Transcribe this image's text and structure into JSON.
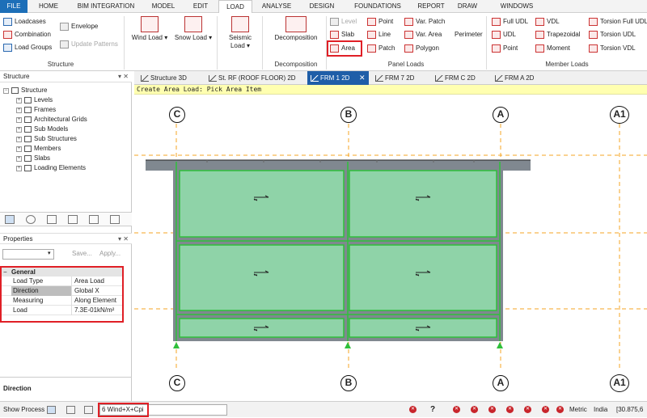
{
  "menu": {
    "items": [
      "FILE",
      "HOME",
      "BIM INTEGRATION",
      "MODEL",
      "EDIT",
      "LOAD",
      "ANALYSE",
      "DESIGN",
      "FOUNDATIONS",
      "REPORT",
      "DRAW",
      "WINDOWS"
    ],
    "active": "LOAD"
  },
  "ribbon": {
    "structure": {
      "loadcases": "Loadcases",
      "combination": "Combination",
      "load_groups": "Load Groups",
      "envelope": "Envelope",
      "update_patterns": "Update Patterns",
      "label": "Structure"
    },
    "wind_load": "Wind Load",
    "snow_load": "Snow Load",
    "seismic_load": "Seismic Load",
    "decomposition": {
      "button": "Decomposition",
      "label": "Decomposition"
    },
    "panel_loads": {
      "level": "Level",
      "slab": "Slab",
      "area": "Area",
      "point": "Point",
      "line": "Line",
      "patch": "Patch",
      "var_patch": "Var. Patch",
      "var_area": "Var. Area",
      "polygon": "Polygon",
      "perimeter": "Perimeter",
      "label": "Panel Loads"
    },
    "member_loads": {
      "full_udl": "Full UDL",
      "udl": "UDL",
      "point": "Point",
      "vdl": "VDL",
      "trapezoidal": "Trapezoidal",
      "moment": "Moment",
      "torsion_full_udl": "Torsion Full UDL",
      "torsion_udl": "Torsion UDL",
      "torsion_vdl": "Torsion VDL",
      "label": "Member Loads"
    }
  },
  "tabs": [
    {
      "label": "Structure 3D"
    },
    {
      "label": "St. RF (ROOF FLOOR) 2D"
    },
    {
      "label": "FRM 1 2D",
      "active": true
    },
    {
      "label": "FRM 7 2D"
    },
    {
      "label": "FRM C 2D"
    },
    {
      "label": "FRM A 2D"
    }
  ],
  "structure_panel": {
    "title": "Structure",
    "root": "Structure",
    "children": [
      "Levels",
      "Frames",
      "Architectural Grids",
      "Sub Models",
      "Sub Structures",
      "Members",
      "Slabs",
      "Loading Elements"
    ]
  },
  "properties_panel": {
    "title": "Properties",
    "save": "Save...",
    "apply": "Apply...",
    "group": "General",
    "rows": [
      {
        "key": "Load Type",
        "value": "Area Load"
      },
      {
        "key": "Direction",
        "value": "Global X"
      },
      {
        "key": "Measuring",
        "value": "Along Element"
      },
      {
        "key": "Load",
        "value": "7.3E-01kN/m²"
      }
    ],
    "description_title": "Direction"
  },
  "canvas": {
    "prompt": "Create Area Load: Pick Area Item",
    "grid_labels": [
      "C",
      "B",
      "A",
      "A1"
    ],
    "colors": {
      "panel": "#8fd3a8",
      "frame": "#808890",
      "grid": "#f5a623",
      "edge": "#2fbf3a"
    }
  },
  "statusbar": {
    "show_process": "Show Process",
    "loadcase": "6 Wind+X+Cpi",
    "units": "Metric",
    "code": "India",
    "coords": "[30.875,6"
  }
}
